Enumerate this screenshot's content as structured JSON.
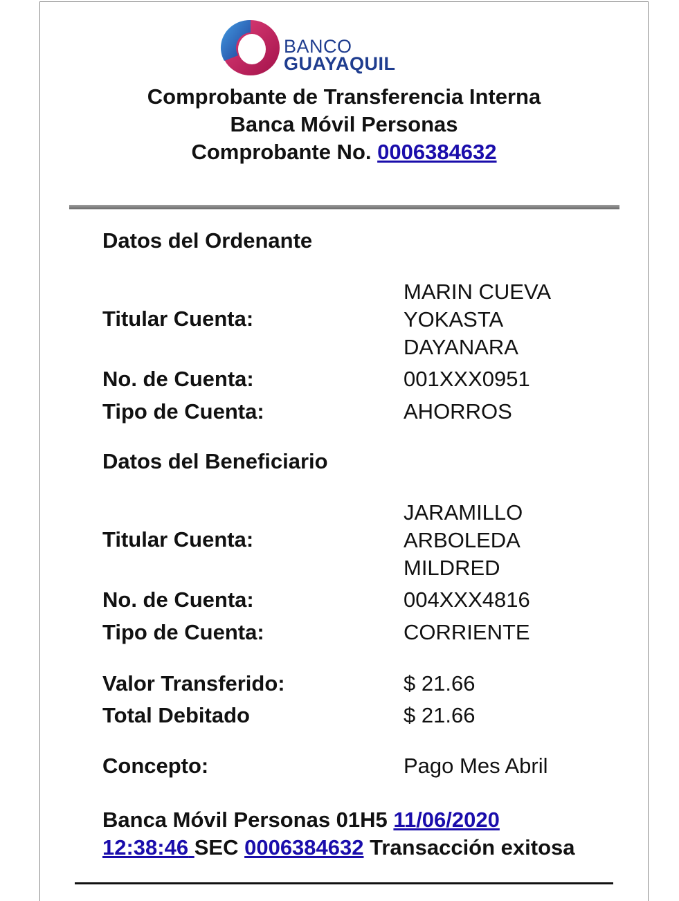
{
  "logo": {
    "line1": "BANCO",
    "line2": "GUAYAQUIL",
    "colors": {
      "magenta": "#c2185b",
      "blue": "#1f5fbf",
      "text": "#1f3d8f"
    }
  },
  "header": {
    "title": "Comprobante de Transferencia Interna",
    "subtitle": "Banca Móvil Personas",
    "number_label": "Comprobante No.",
    "number": "0006384632"
  },
  "ordenante": {
    "section_title": "Datos del Ordenante",
    "titular_label": "Titular Cuenta:",
    "titular_lines": [
      "MARIN CUEVA",
      "YOKASTA",
      "DAYANARA"
    ],
    "cuenta_label": "No. de Cuenta:",
    "cuenta_value": "001XXX0951",
    "tipo_label": "Tipo de Cuenta:",
    "tipo_value": "AHORROS"
  },
  "beneficiario": {
    "section_title": "Datos del Beneficiario",
    "titular_label": "Titular Cuenta:",
    "titular_lines": [
      "JARAMILLO",
      "ARBOLEDA",
      "MILDRED"
    ],
    "cuenta_label": "No. de Cuenta:",
    "cuenta_value": "004XXX4816",
    "tipo_label": "Tipo de Cuenta:",
    "tipo_value": "CORRIENTE"
  },
  "montos": {
    "valor_label": "Valor Transferido:",
    "valor_value": "$ 21.66",
    "total_label": "Total Debitado",
    "total_value": "$ 21.66"
  },
  "concepto": {
    "label": "Concepto:",
    "value": "Pago Mes Abril"
  },
  "footer": {
    "prefix": "Banca Móvil Personas 01H5",
    "date": "11/06/2020",
    "time": "12:38:46",
    "sec_label": "SEC",
    "sec_number": "0006384632",
    "status": "Transacción exitosa"
  },
  "link_color": "#1a0dab"
}
